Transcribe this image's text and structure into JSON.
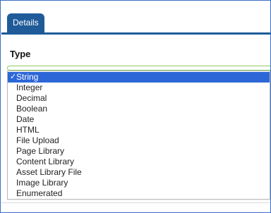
{
  "tabs": [
    {
      "label": "Details",
      "selected": true
    }
  ],
  "field": {
    "label": "Type"
  },
  "dropdown": {
    "selected_value": "String",
    "options": [
      {
        "label": "String",
        "selected": true
      },
      {
        "label": "Integer",
        "selected": false
      },
      {
        "label": "Decimal",
        "selected": false
      },
      {
        "label": "Boolean",
        "selected": false
      },
      {
        "label": "Date",
        "selected": false
      },
      {
        "label": "HTML",
        "selected": false
      },
      {
        "label": "File Upload",
        "selected": false
      },
      {
        "label": "Page Library",
        "selected": false
      },
      {
        "label": "Content Library",
        "selected": false
      },
      {
        "label": "Asset Library File",
        "selected": false
      },
      {
        "label": "Image Library",
        "selected": false
      },
      {
        "label": "Enumerated",
        "selected": false
      }
    ]
  },
  "colors": {
    "tab_blue": "#1f5b99",
    "selection_blue": "#2d67d7",
    "select_focus_green": "#8dc866",
    "frame_blue": "#3b6fc4"
  }
}
